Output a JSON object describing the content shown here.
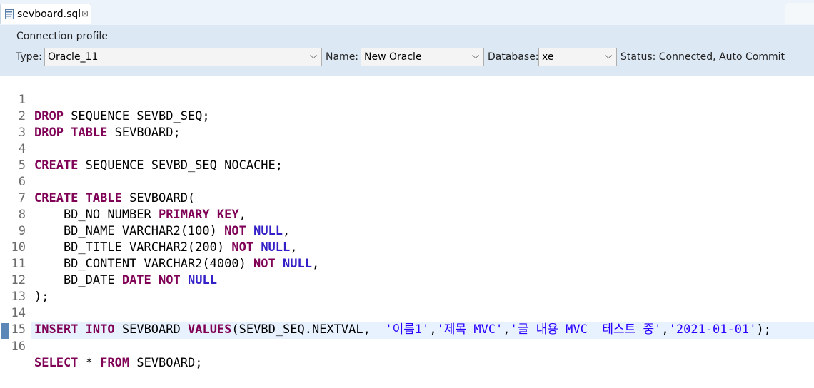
{
  "tab": {
    "label": "sevboard.sql",
    "close": "⊠"
  },
  "connection": {
    "title": "Connection profile",
    "type_label": "Type:",
    "type_value": "Oracle_11",
    "name_label": "Name:",
    "name_value": "New Oracle",
    "database_label": "Database:",
    "database_value": "xe",
    "status": "Status: Connected, Auto Commit"
  },
  "editor": {
    "line_numbers": [
      "1",
      "2",
      "3",
      "4",
      "5",
      "6",
      "7",
      "8",
      "9",
      "10",
      "11",
      "12",
      "13",
      "14",
      "15",
      "16"
    ],
    "l1": {
      "k1": "DROP",
      "t1": " SEQUENCE SEVBD_SEQ;"
    },
    "l2": {
      "k1": "DROP",
      "sp": " ",
      "k2": "TABLE",
      "t1": " SEVBOARD;"
    },
    "l4": {
      "k1": "CREATE",
      "t1": " SEQUENCE SEVBD_SEQ NOCACHE;"
    },
    "l6": {
      "k1": "CREATE",
      "sp": " ",
      "k2": "TABLE",
      "t1": " SEVBOARD("
    },
    "l7": {
      "t1": "    BD_NO NUMBER ",
      "k1": "PRIMARY",
      "sp": " ",
      "k2": "KEY",
      "t2": ","
    },
    "l8": {
      "t1": "    BD_NAME VARCHAR2(100) ",
      "k1": "NOT",
      "sp": " ",
      "k2": "NULL",
      "t2": ","
    },
    "l9": {
      "t1": "    BD_TITLE VARCHAR2(200) ",
      "k1": "NOT",
      "sp": " ",
      "k2": "NULL",
      "t2": ","
    },
    "l10": {
      "t1": "    BD_CONTENT VARCHAR2(4000) ",
      "k1": "NOT",
      "sp": " ",
      "k2": "NULL",
      "t2": ","
    },
    "l11": {
      "t1": "    BD_DATE ",
      "k1": "DATE",
      "sp": " ",
      "k2": "NOT",
      "sp2": " ",
      "k3": "NULL"
    },
    "l12": {
      "t1": ");"
    },
    "l14": {
      "k1": "INSERT",
      "sp": " ",
      "k2": "INTO",
      "t1": " SEVBOARD ",
      "k3": "VALUES",
      "t2": "(SEVBD_SEQ.NEXTVAL,  ",
      "s1": "'이름1'",
      "c1": ",",
      "s2": "'제목 MVC'",
      "c2": ",",
      "s3": "'글 내용 MVC  테스트 중'",
      "c3": ",",
      "s4": "'2021-01-01'",
      "t3": ");"
    },
    "l16": {
      "k1": "SELECT",
      "t1": " * ",
      "k2": "FROM",
      "t2": " SEVBOARD;"
    }
  },
  "colors": {
    "keyword": "#7f0055",
    "null_keyword": "#3420c7",
    "string": "#2a00ff",
    "current_line": "#e8f2fe",
    "panel": "#dde8f5"
  }
}
